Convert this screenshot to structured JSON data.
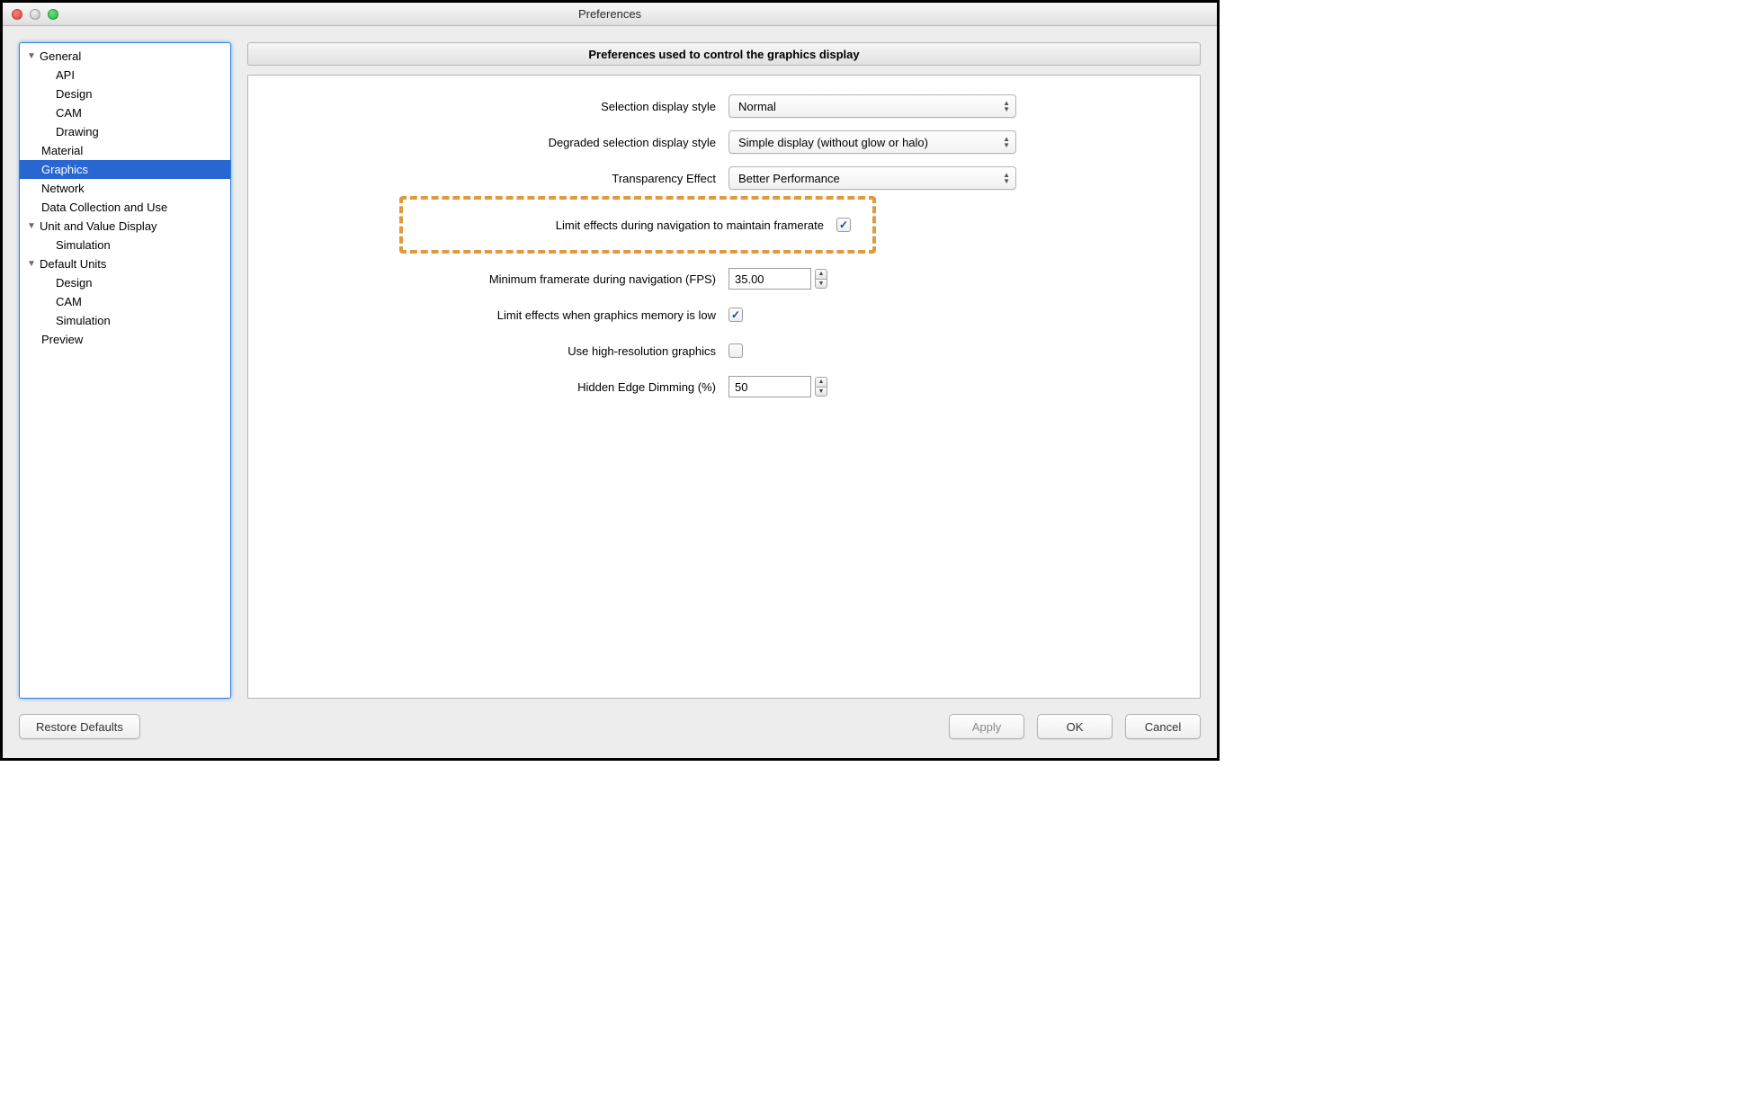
{
  "window_title": "Preferences",
  "sidebar": {
    "items": [
      {
        "label": "General",
        "disclosure": true
      },
      {
        "label": "API"
      },
      {
        "label": "Design"
      },
      {
        "label": "CAM"
      },
      {
        "label": "Drawing"
      },
      {
        "label": "Material"
      },
      {
        "label": "Graphics",
        "selected": true
      },
      {
        "label": "Network"
      },
      {
        "label": "Data Collection and Use"
      },
      {
        "label": "Unit and Value Display",
        "disclosure": true
      },
      {
        "label": "Simulation"
      },
      {
        "label": "Default Units",
        "disclosure": true
      },
      {
        "label": "Design"
      },
      {
        "label": "CAM"
      },
      {
        "label": "Simulation"
      },
      {
        "label": "Preview"
      }
    ]
  },
  "panel": {
    "header": "Preferences used to control the graphics display"
  },
  "form": {
    "selection_label": "Selection display style",
    "selection_value": "Normal",
    "degraded_label": "Degraded selection display style",
    "degraded_value": "Simple display (without glow or halo)",
    "transparency_label": "Transparency Effect",
    "transparency_value": "Better Performance",
    "limit_nav_label": "Limit effects during navigation to maintain framerate",
    "limit_nav_checked": true,
    "min_fps_label": "Minimum framerate during navigation (FPS)",
    "min_fps_value": "35.00",
    "limit_mem_label": "Limit effects when graphics memory is low",
    "limit_mem_checked": true,
    "highres_label": "Use high-resolution graphics",
    "highres_checked": false,
    "dimming_label": "Hidden Edge Dimming (%)",
    "dimming_value": "50"
  },
  "buttons": {
    "restore": "Restore Defaults",
    "apply": "Apply",
    "ok": "OK",
    "cancel": "Cancel"
  }
}
